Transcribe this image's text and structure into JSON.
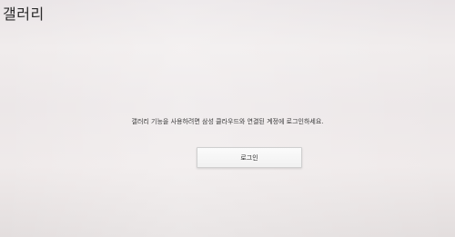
{
  "app": {
    "title": "갤러리"
  },
  "main": {
    "message": "갤러리 기능을 사용하려면 삼성 클라우드와 연결된 계정에 로그인하세요.",
    "login_button_label": "로그인"
  }
}
